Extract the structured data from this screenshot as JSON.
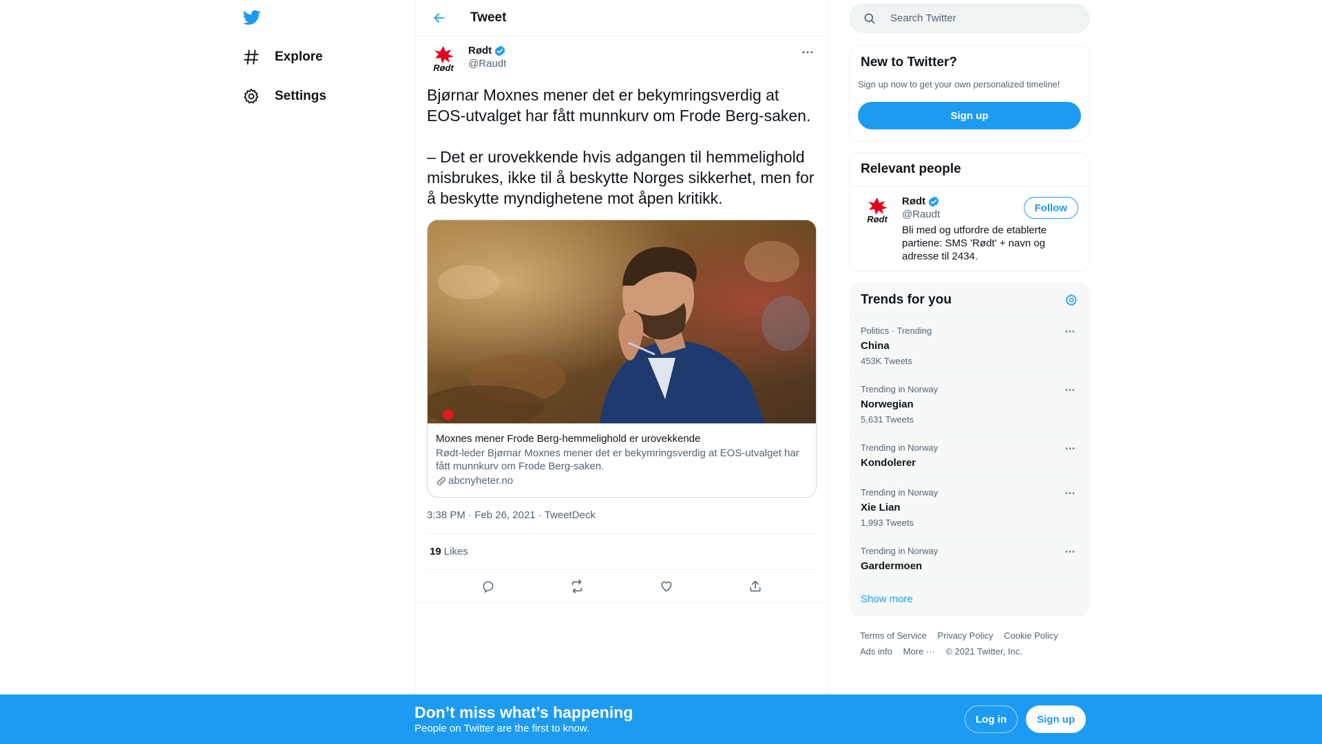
{
  "colors": {
    "accent": "#1d9bf0",
    "text": "#0f1419",
    "secondary": "#536471",
    "party_red": "#e4001b"
  },
  "nav": {
    "logo_icon": "twitter-bird-icon",
    "items": [
      {
        "label": "Explore",
        "icon": "hashtag-icon"
      },
      {
        "label": "Settings",
        "icon": "gear-icon"
      }
    ]
  },
  "header": {
    "title": "Tweet"
  },
  "tweet": {
    "author_name": "Rødt",
    "author_handle": "@Raudt",
    "avatar_text": "Rødt",
    "text": "Bjørnar Moxnes mener det er bekymringsverdig at EOS-utvalget har fått munnkurv om Frode Berg-saken.\n\n– Det er urovekkende hvis adgangen til hemmelighold misbrukes, ikke til å beskytte Norges sikkerhet, men for å beskytte myndighetene mot åpen kritikk.",
    "card": {
      "title": "Moxnes mener Frode Berg-hemmelighold er urovekkende",
      "description": "Rødt-leder Bjørnar Moxnes mener det er bekymringsverdig at EOS-utvalget har fått munnkurv om Frode Berg-saken.",
      "domain": "abcnyheter.no"
    },
    "time": "3:38 PM",
    "date": "Feb 26, 2021",
    "source": "TweetDeck",
    "likes_count": "19",
    "likes_label": "Likes"
  },
  "search": {
    "placeholder": "Search Twitter"
  },
  "new_to_twitter": {
    "title": "New to Twitter?",
    "subtitle": "Sign up now to get your own personalized timeline!",
    "button": "Sign up"
  },
  "relevant_people": {
    "title": "Relevant people",
    "name": "Rødt",
    "handle": "@Raudt",
    "bio": "Bli med og utfordre de etablerte partiene: SMS 'Rødt' + navn og adresse til 2434.",
    "follow": "Follow"
  },
  "trends": {
    "title": "Trends for you",
    "items": [
      {
        "meta": "Politics · Trending",
        "name": "China",
        "count": "453K Tweets"
      },
      {
        "meta": "Trending in Norway",
        "name": "Norwegian",
        "count": "5,631 Tweets"
      },
      {
        "meta": "Trending in Norway",
        "name": "Kondolerer",
        "count": ""
      },
      {
        "meta": "Trending in Norway",
        "name": "Xie Lian",
        "count": "1,993 Tweets"
      },
      {
        "meta": "Trending in Norway",
        "name": "Gardermoen",
        "count": ""
      }
    ],
    "show_more": "Show more"
  },
  "footer": {
    "links": [
      "Terms of Service",
      "Privacy Policy",
      "Cookie Policy",
      "Ads info",
      "More ···"
    ],
    "copyright": "© 2021 Twitter, Inc."
  },
  "bottom_bar": {
    "title": "Don’t miss what’s happening",
    "subtitle": "People on Twitter are the first to know.",
    "login": "Log in",
    "signup": "Sign up"
  }
}
